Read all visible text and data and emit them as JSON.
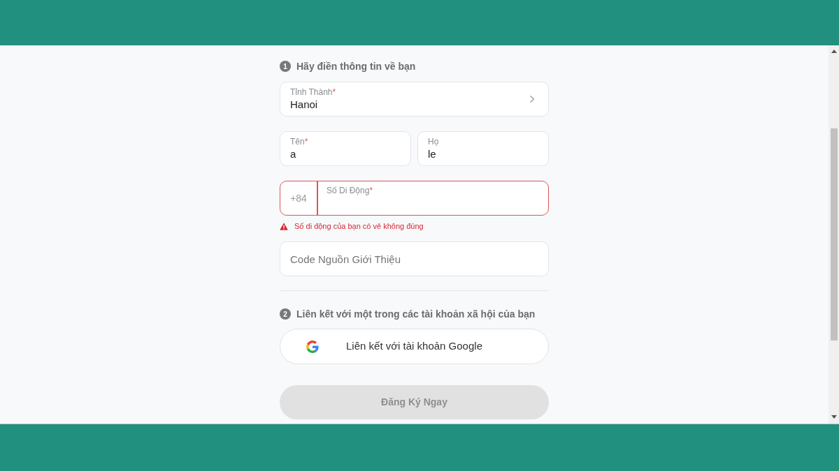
{
  "step_1": {
    "number": "1",
    "title": "Hãy điền thông tin về bạn"
  },
  "fields": [
    {
      "kind": "select",
      "label": "Tỉnh Thành",
      "required_mark": "*",
      "value": "Hanoi"
    },
    {
      "kind": "pair",
      "items": [
        {
          "kind": "text",
          "label": "Tên",
          "required_mark": "*",
          "value": "a"
        },
        {
          "kind": "text",
          "label": "Họ",
          "value": "le"
        }
      ]
    },
    {
      "kind": "phone",
      "prefix": "+84",
      "label": "Số Di Động",
      "required_mark": "*",
      "invalid": true,
      "error": "Số di động của bạn có vẻ không đúng"
    },
    {
      "kind": "text",
      "placeholder": "Code Nguồn Giới Thiệu"
    }
  ],
  "step_2": {
    "number": "2",
    "title": "Liên kết với một trong các tài khoản xã hội của bạn"
  },
  "google_button": {
    "label": "Liên kết với tài khoản Google"
  },
  "submit_button": {
    "label": "Đăng Ký Ngay",
    "disabled": true
  }
}
